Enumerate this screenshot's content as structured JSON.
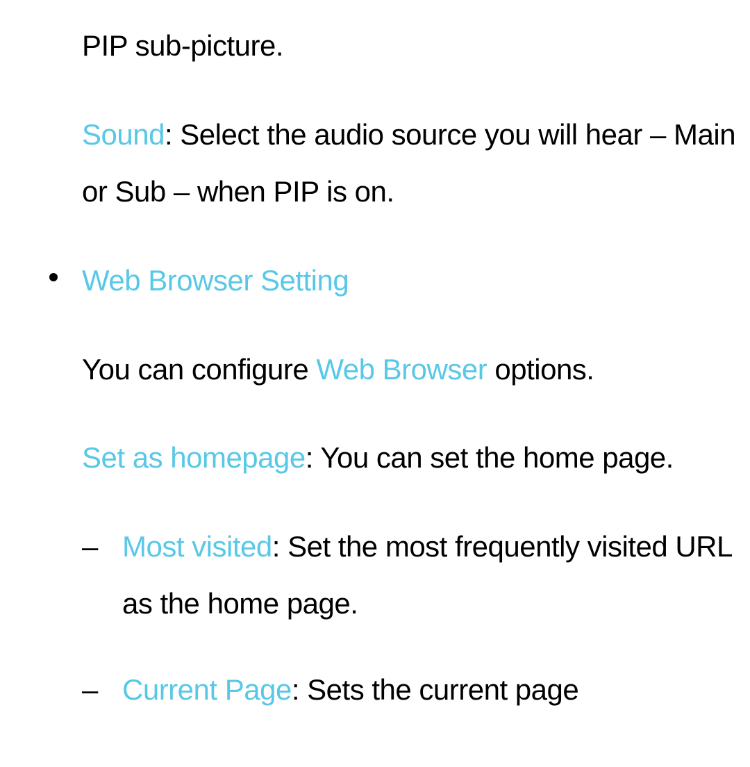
{
  "p_pip_fragment": "PIP sub-picture.",
  "sound": {
    "label": "Sound",
    "desc": ": Select the audio source you will hear – Main or Sub – when PIP is on."
  },
  "web_browser_setting": {
    "heading": "Web Browser Setting",
    "desc_pre": "You can configure ",
    "desc_hl": "Web Browser",
    "desc_post": " options."
  },
  "set_homepage": {
    "label": "Set as homepage",
    "desc": ": You can set the home page."
  },
  "dash": "–",
  "most_visited": {
    "label": "Most visited",
    "desc": ": Set the most frequently visited URL as the home page."
  },
  "current_page": {
    "label": "Current Page",
    "desc": ": Sets the current page"
  }
}
